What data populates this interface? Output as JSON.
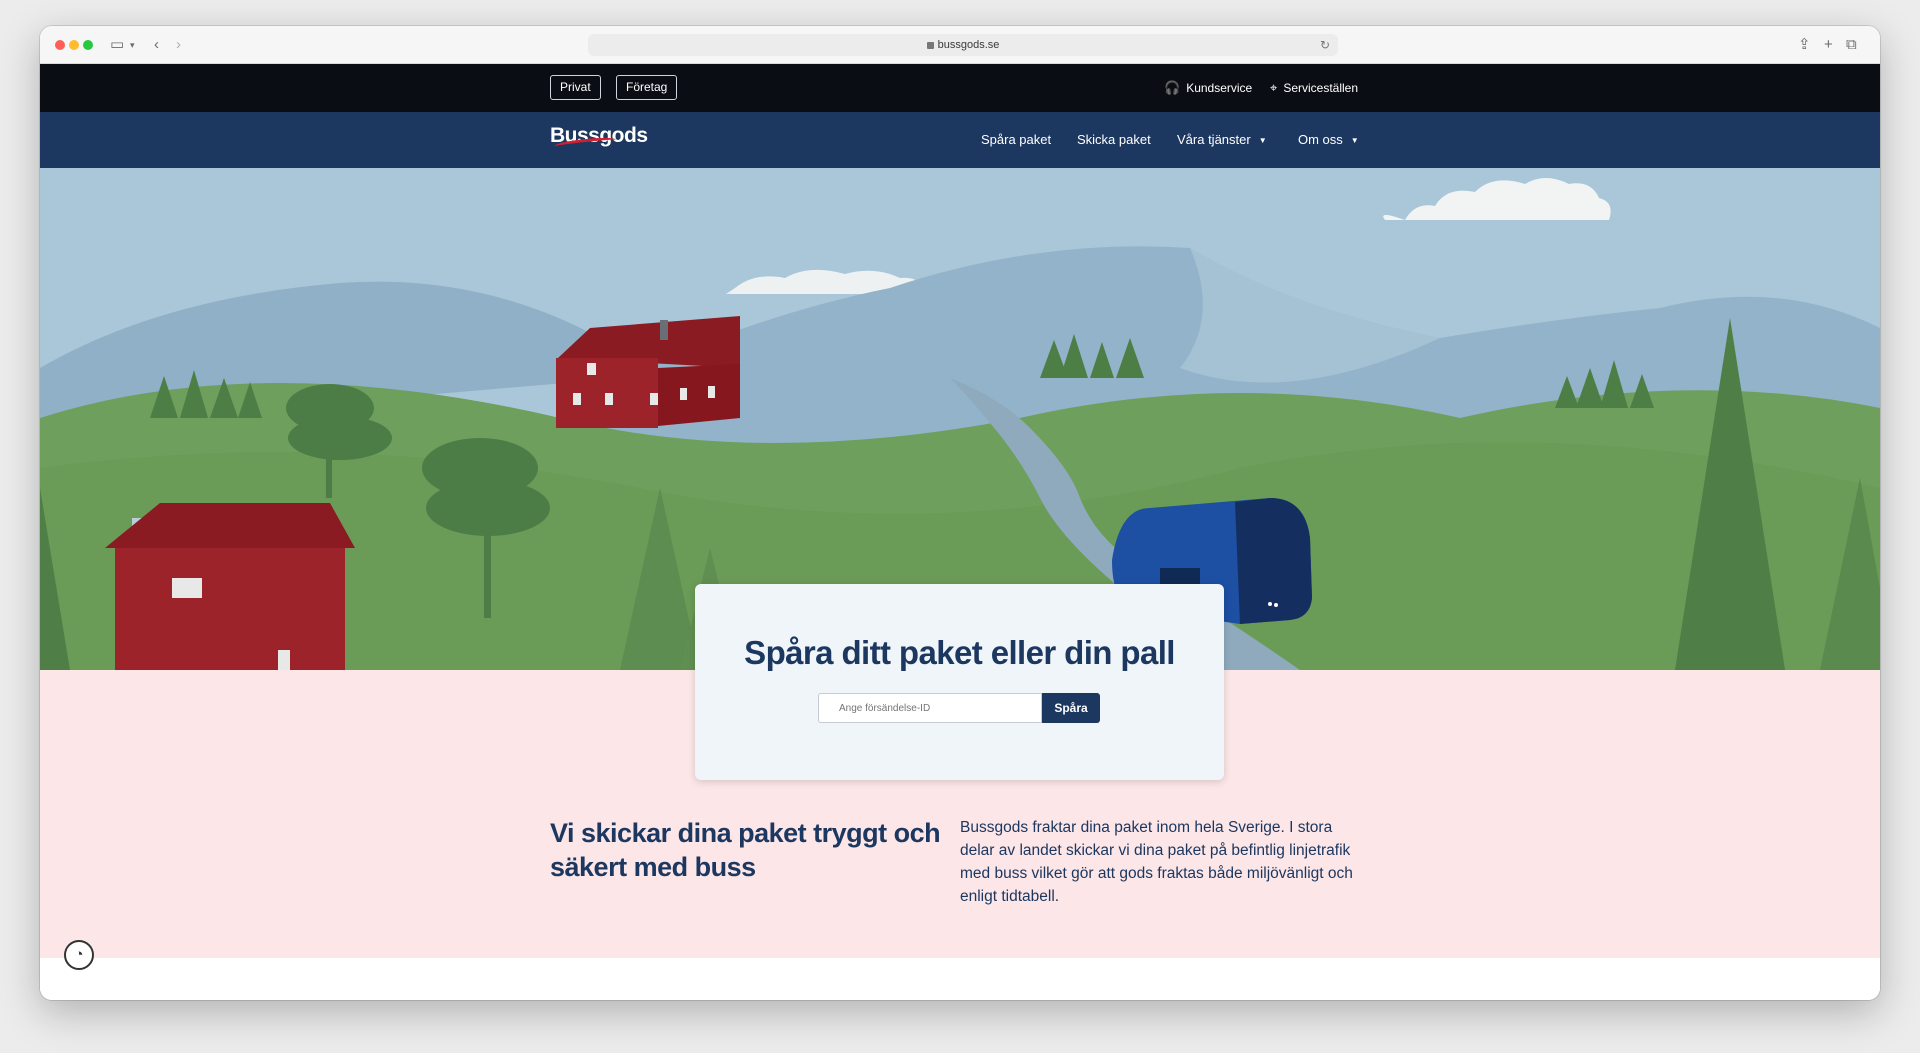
{
  "browser": {
    "url": "bussgods.se"
  },
  "topbar": {
    "segments": [
      "Privat",
      "Företag"
    ],
    "customer_service": "Kundservice",
    "service_points": "Serviceställen"
  },
  "nav": {
    "logo": "Bussgods",
    "items": [
      {
        "label": "Spåra paket"
      },
      {
        "label": "Skicka paket"
      },
      {
        "label": "Våra tjänster"
      },
      {
        "label": "Om oss"
      }
    ]
  },
  "tracking": {
    "title": "Spåra ditt paket eller din pall",
    "placeholder": "Ange försändelse-ID",
    "button": "Spåra"
  },
  "intro": {
    "headline": "Vi skickar dina paket tryggt och säkert med buss",
    "body": "Bussgods fraktar dina paket inom hela Sverige. I stora delar av landet skickar vi dina paket på befintlig linjetrafik med buss vilket gör att gods fraktas både miljövänligt och enligt tidtabell."
  },
  "colors": {
    "navy": "#1c3760",
    "topbar": "#0b0d14",
    "pink": "#fce6e7",
    "brand_red": "#d32030"
  }
}
